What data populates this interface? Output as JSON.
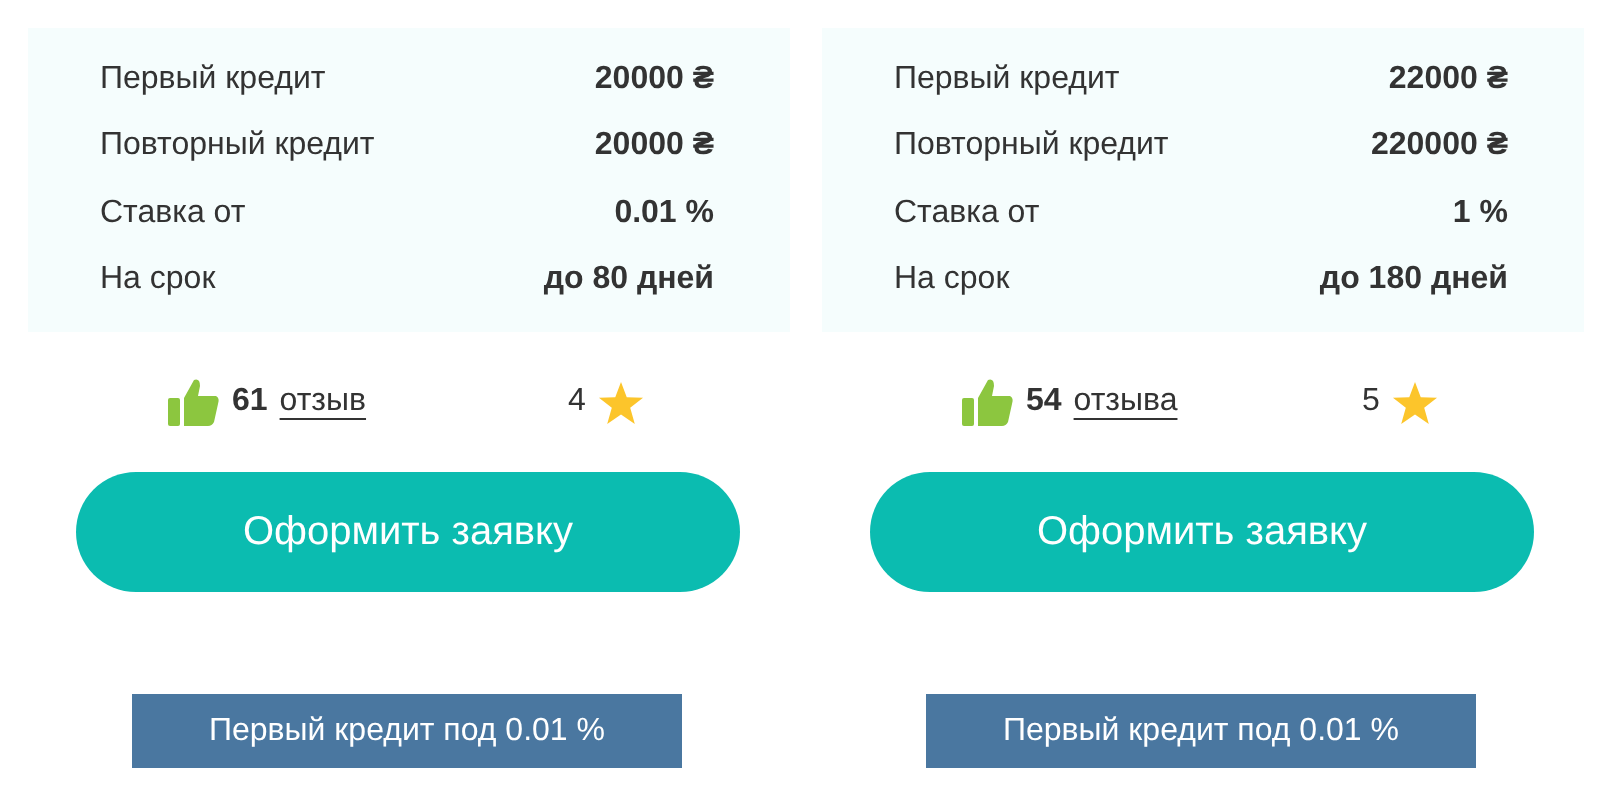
{
  "offers": [
    {
      "details": [
        {
          "label": "Первый кредит",
          "value": "20000 ₴"
        },
        {
          "label": "Повторный кредит",
          "value": "20000 ₴"
        },
        {
          "label": "Ставка от",
          "value": "0.01 %"
        },
        {
          "label": "На срок",
          "value": "до 80 дней"
        }
      ],
      "review_count": "61",
      "review_link": "отзыв",
      "rating": "4",
      "apply_button": "Оформить заявку",
      "promo": "Первый кредит под 0.01 %"
    },
    {
      "details": [
        {
          "label": "Первый кредит",
          "value": "22000 ₴"
        },
        {
          "label": "Повторный кредит",
          "value": "220000 ₴"
        },
        {
          "label": "Ставка от",
          "value": "1 %"
        },
        {
          "label": "На срок",
          "value": "до 180 дней"
        }
      ],
      "review_count": "54",
      "review_link": "отзыва",
      "rating": "5",
      "apply_button": "Оформить заявку",
      "promo": "Первый кредит под 0.01 %"
    }
  ]
}
